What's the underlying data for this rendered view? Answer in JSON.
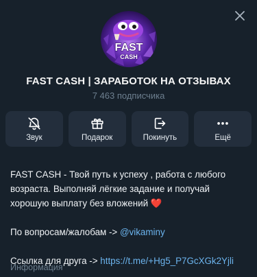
{
  "header": {
    "close_icon": "close-icon"
  },
  "channel": {
    "avatar_text_line1": "FAST",
    "avatar_text_line2": "CASH",
    "title": "FAST CASH | ЗАРАБОТОК НА ОТЗЫВАХ",
    "subscribers": "7 463 подписчика"
  },
  "actions": {
    "mute": {
      "label": "Звук",
      "icon": "bell-off-icon"
    },
    "gift": {
      "label": "Подарок",
      "icon": "gift-icon"
    },
    "leave": {
      "label": "Покинуть",
      "icon": "leave-icon"
    },
    "more": {
      "label": "Ещё",
      "icon": "more-icon"
    }
  },
  "description": {
    "line1": "FAST CASH - Твой путь к успеху , работа с любого возраста. Выполняй лёгкие задание и получай хорошую выплату без вложений ",
    "heart": "❤️",
    "contact_prefix": "По вопросам/жалобам -> ",
    "contact_link": "@vikaminy",
    "friend_prefix": "Ссылка для друга -> ",
    "friend_link": "https://t.me/+Hg5_P7GcXGk2Yjli",
    "caption": "Информация"
  },
  "colors": {
    "background": "#17212b",
    "button_bg": "#232e3c",
    "link": "#6cb4ee",
    "muted_text": "#6d7f8f"
  }
}
